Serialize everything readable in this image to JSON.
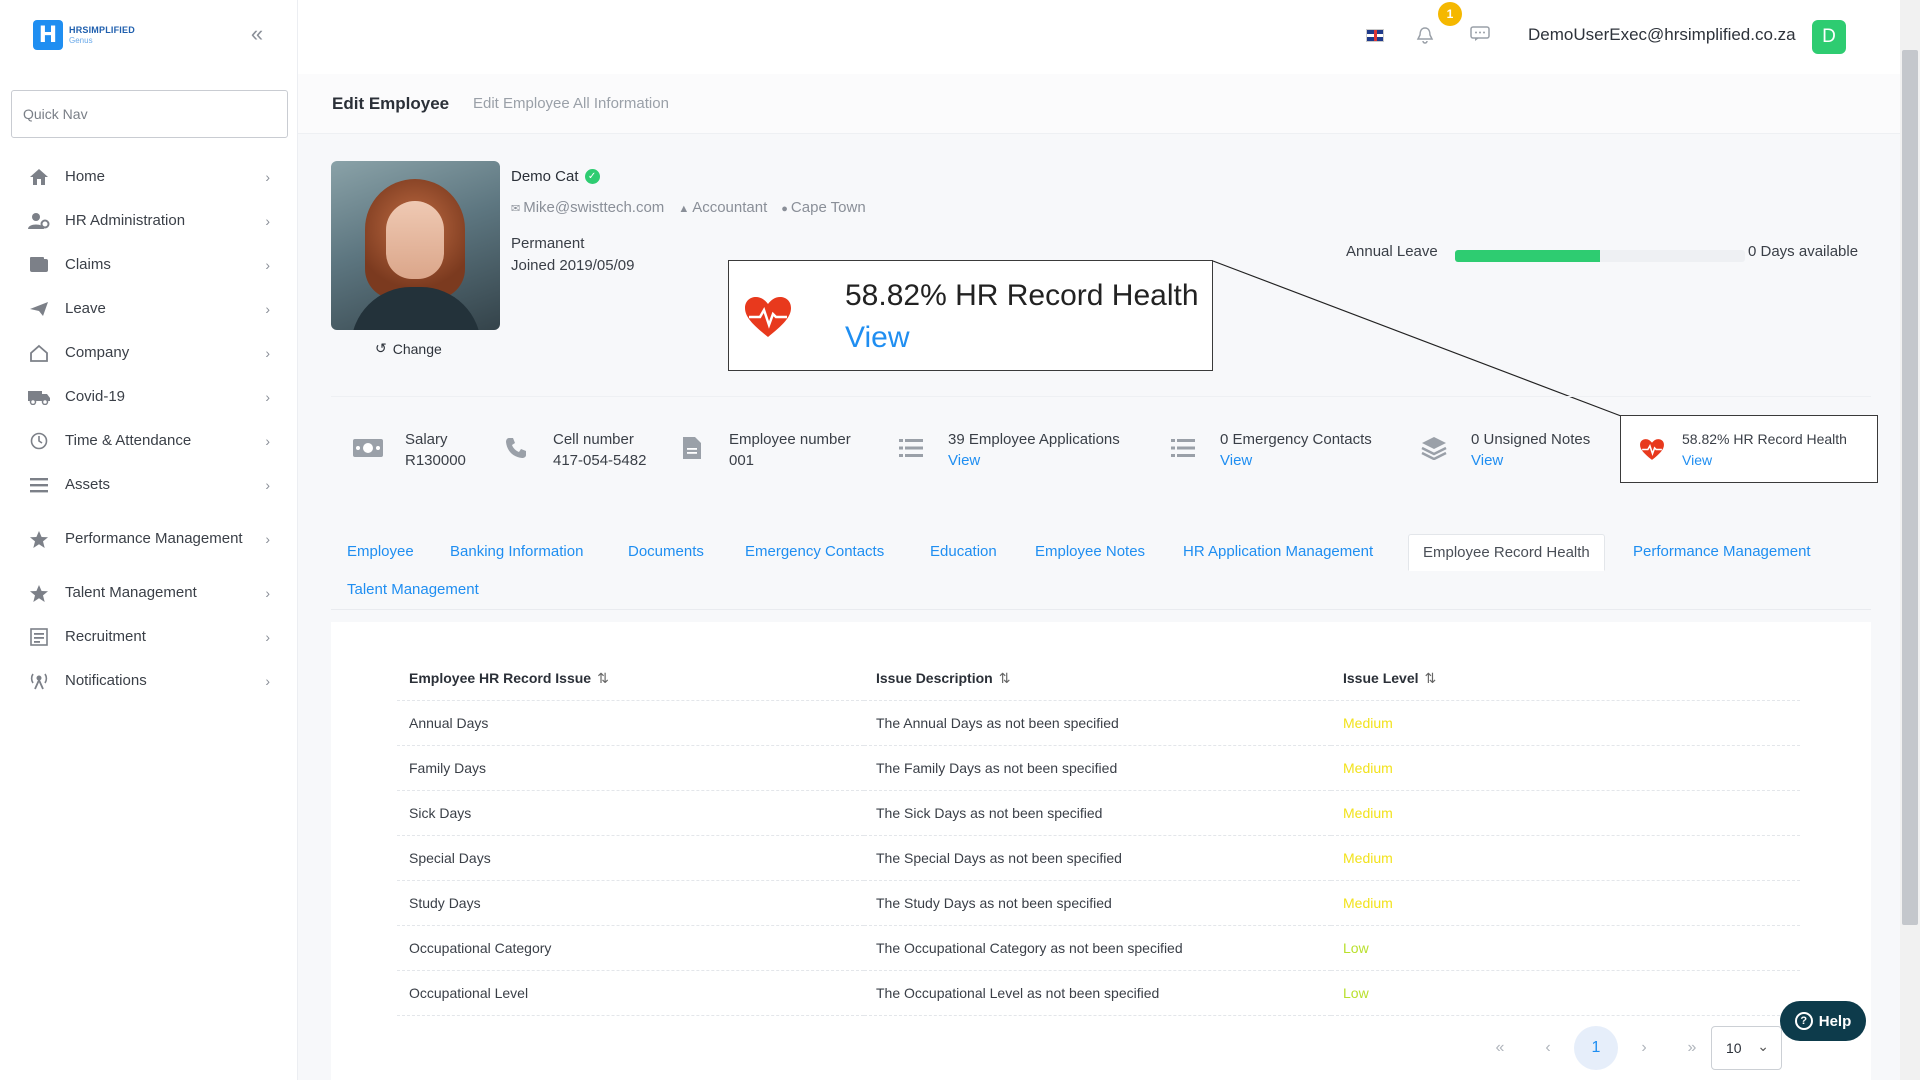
{
  "brand": {
    "line1": "HRSIMPLIFIED",
    "line2": "Genus",
    "mark": "H"
  },
  "sidebar": {
    "quick_nav_placeholder": "Quick Nav",
    "items": [
      {
        "label": "Home",
        "icon": "home-icon"
      },
      {
        "label": "HR Administration",
        "icon": "users-gear-icon"
      },
      {
        "label": "Claims",
        "icon": "wallet-icon"
      },
      {
        "label": "Leave",
        "icon": "paper-plane-icon"
      },
      {
        "label": "Company",
        "icon": "building-icon"
      },
      {
        "label": "Covid-19",
        "icon": "truck-icon"
      },
      {
        "label": "Time & Attendance",
        "icon": "clock-icon"
      },
      {
        "label": "Assets",
        "icon": "list-icon"
      },
      {
        "label": "Performance Management",
        "icon": "star-icon"
      },
      {
        "label": "Talent Management",
        "icon": "star-icon"
      },
      {
        "label": "Recruitment",
        "icon": "document-icon"
      },
      {
        "label": "Notifications",
        "icon": "broadcast-icon"
      }
    ]
  },
  "topbar": {
    "notification_count": "1",
    "user_email": "DemoUserExec@hrsimplified.co.za",
    "avatar_letter": "D"
  },
  "header": {
    "title": "Edit Employee",
    "subtitle": "Edit Employee All Information"
  },
  "profile": {
    "name": "Demo Cat",
    "email": "Mike@swisttech.com",
    "position": "Accountant",
    "location": "Cape Town",
    "employment_type": "Permanent",
    "joined": "Joined 2019/05/09",
    "change_label": "Change"
  },
  "health_callout": {
    "title": "58.82% HR Record Health",
    "link": "View"
  },
  "annual_leave": {
    "label": "Annual Leave",
    "fill_percent": 50,
    "days_available": "0 Days available"
  },
  "stats": {
    "salary_label": "Salary",
    "salary_value": "R130000",
    "cell_label": "Cell number",
    "cell_value": "417-054-5482",
    "empno_label": "Employee number",
    "empno_value": "001",
    "applications_label": "39 Employee Applications",
    "applications_link": "View",
    "contacts_label": "0 Emergency Contacts",
    "contacts_link": "View",
    "notes_label": "0 Unsigned Notes",
    "notes_link": "View",
    "health_label": "58.82% HR Record Health",
    "health_link": "View"
  },
  "tabs": [
    "Employee",
    "Banking Information",
    "Documents",
    "Emergency Contacts",
    "Education",
    "Employee Notes",
    "HR Application Management",
    "Employee Record Health",
    "Performance Management",
    "Talent Management"
  ],
  "table": {
    "headers": [
      "Employee HR Record Issue",
      "Issue Description",
      "Issue Level"
    ],
    "rows": [
      {
        "issue": "Annual Days",
        "description": "The Annual Days as not been specified",
        "level": "Medium"
      },
      {
        "issue": "Family Days",
        "description": "The Family Days as not been specified",
        "level": "Medium"
      },
      {
        "issue": "Sick Days",
        "description": "The Sick Days as not been specified",
        "level": "Medium"
      },
      {
        "issue": "Special Days",
        "description": "The Special Days as not been specified",
        "level": "Medium"
      },
      {
        "issue": "Study Days",
        "description": "The Study Days as not been specified",
        "level": "Medium"
      },
      {
        "issue": "Occupational Category",
        "description": "The Occupational Category as not been specified",
        "level": "Low"
      },
      {
        "issue": "Occupational Level",
        "description": "The Occupational Level as not been specified",
        "level": "Low"
      }
    ]
  },
  "pager": {
    "first": "«",
    "prev": "‹",
    "current": "1",
    "next": "›",
    "last": "»",
    "page_size": "10"
  },
  "help_label": "Help",
  "colors": {
    "accent": "#1f8ef1",
    "success": "#2ecc71",
    "medium": "#f2e21c",
    "low": "#b9e02c",
    "health_red": "#e8391d"
  }
}
